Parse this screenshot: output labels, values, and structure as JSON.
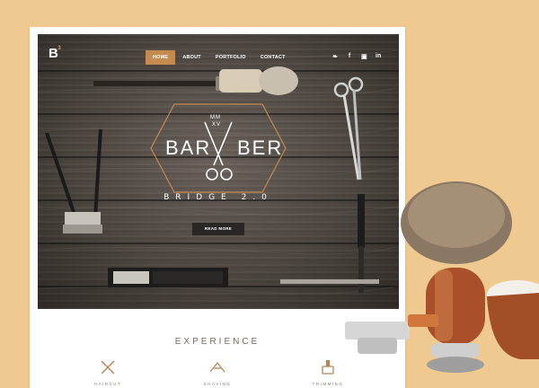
{
  "brand": {
    "logo": "B",
    "logo_mark": "3"
  },
  "nav": {
    "items": [
      {
        "label": "HOME",
        "active": true
      },
      {
        "label": "ABOUT",
        "active": false
      },
      {
        "label": "PORTFOLIO",
        "active": false
      },
      {
        "label": "CONTACT",
        "active": false
      }
    ],
    "social_icons": [
      "twitter-icon",
      "facebook-icon",
      "instagram-icon",
      "linkedin-icon"
    ],
    "social_glyphs": [
      "❧",
      "f",
      "▣",
      "in"
    ]
  },
  "hero": {
    "emblem_top": "MM",
    "emblem_sub": "XV",
    "title_left": "BAR",
    "title_right": "BER",
    "subtitle": "BRIDGE 2.0",
    "cta_label": "READ MORE"
  },
  "section": {
    "title": "EXPERIENCE",
    "services": [
      {
        "label": "HAIRCUT",
        "icon": "crossed-scissors-icon"
      },
      {
        "label": "SHAVING",
        "icon": "razor-icon"
      },
      {
        "label": "TRIMMING",
        "icon": "brush-icon"
      }
    ]
  },
  "colors": {
    "page_background": "#efc98f",
    "accent": "#c48a4f",
    "hero_wood": "#4d4640",
    "button_dark": "#2a2624"
  }
}
